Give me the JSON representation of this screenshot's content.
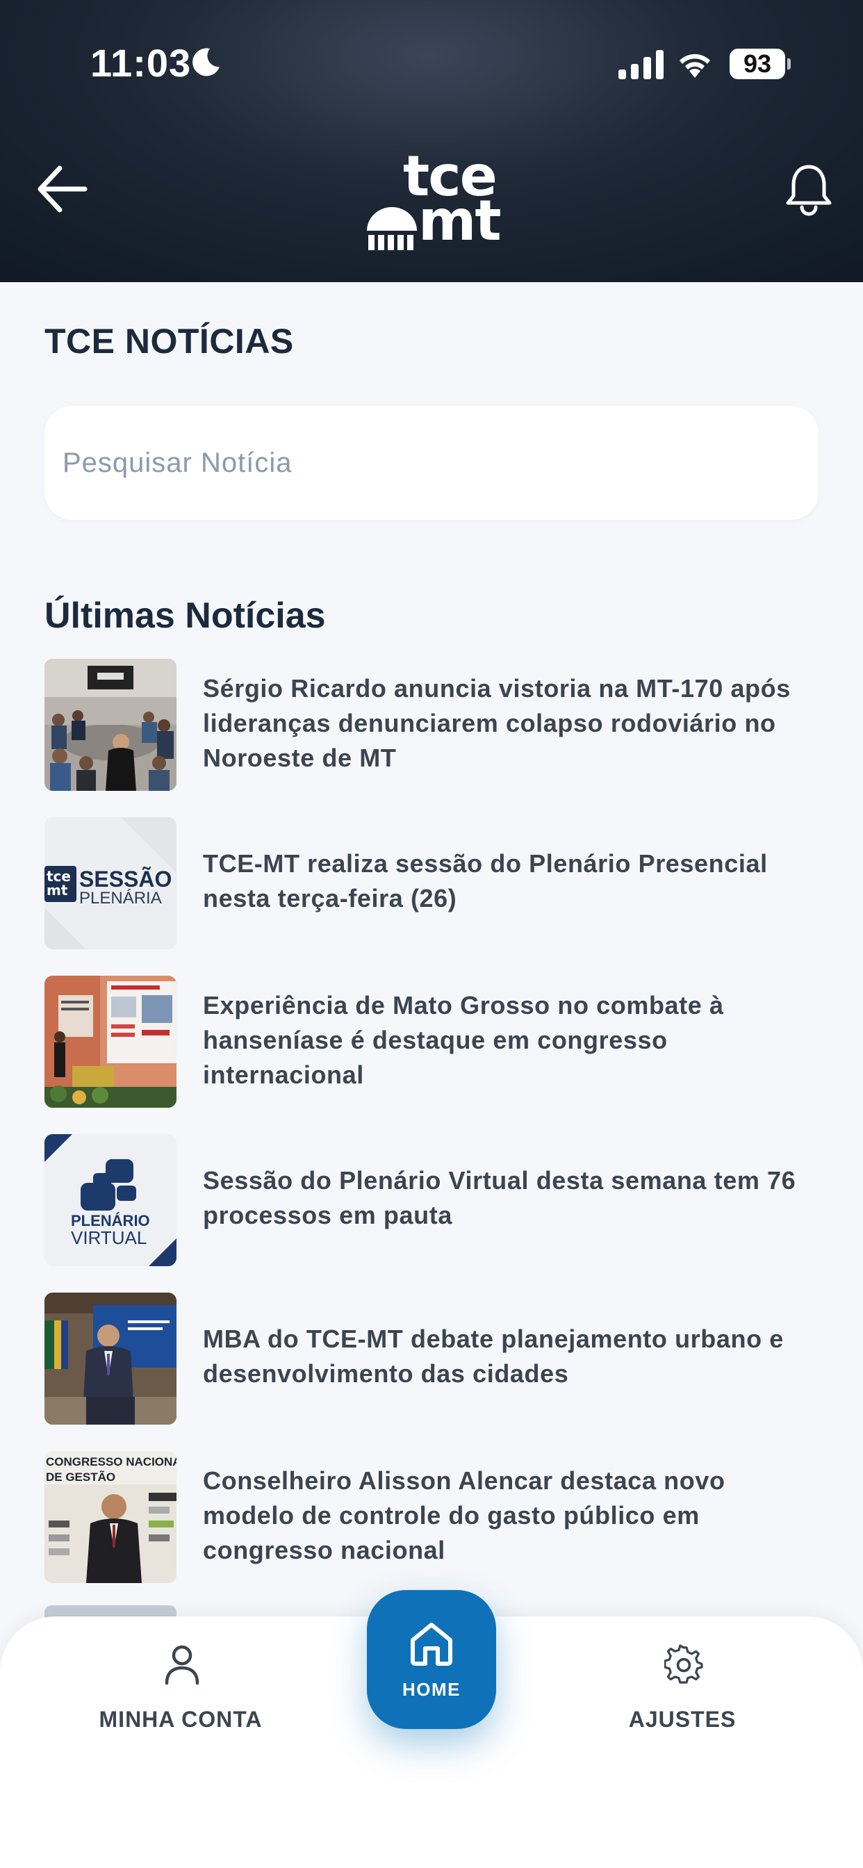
{
  "status_bar": {
    "time": "11:03",
    "battery": "93"
  },
  "header": {
    "logo_top": "tce",
    "logo_bottom": "mt"
  },
  "page": {
    "title": "TCE NOTÍCIAS",
    "search_placeholder": "Pesquisar Notícia",
    "latest_title": "Últimas Notícias"
  },
  "news": [
    {
      "title": "Sérgio Ricardo anuncia vistoria na MT-170 após lideranças denunciarem colapso rodoviário no Noroeste de MT",
      "thumb": "meeting-photo"
    },
    {
      "title": "TCE-MT realiza sessão do Plenário Presencial nesta terça-feira (26)",
      "thumb": "sessao-plenaria-card",
      "thumb_text_1": "SESSÃO",
      "thumb_text_2": "PLENÁRIA",
      "thumb_logo_1": "tce",
      "thumb_logo_2": "mt"
    },
    {
      "title": "Experiência de Mato Grosso no combate à hanseníase é destaque em congresso internacional",
      "thumb": "presentation-photo"
    },
    {
      "title": "Sessão do Plenário Virtual desta semana tem 76 processos em pauta",
      "thumb": "plenario-virtual-card",
      "thumb_text_1": "PLENÁRIO",
      "thumb_text_2": "VIRTUAL"
    },
    {
      "title": "MBA do TCE-MT debate planejamento urbano e desenvolvimento das cidades",
      "thumb": "speaker-photo"
    },
    {
      "title": "Conselheiro Alisson Alencar destaca novo modelo de controle do gasto público em congresso nacional",
      "thumb": "congress-photo",
      "thumb_text_1": "CONGRESSO NACIONAL",
      "thumb_text_2": "DE GESTÃO"
    }
  ],
  "bottom_nav": {
    "left_label": "MINHA CONTA",
    "home_label": "HOME",
    "right_label": "AJUSTES"
  },
  "colors": {
    "primary": "#0f72b8",
    "text_dark": "#1c2a3e",
    "background": "#f5f7fa"
  }
}
